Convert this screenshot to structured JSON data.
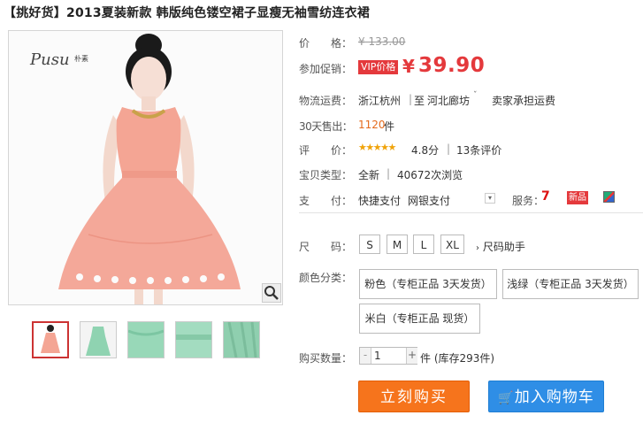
{
  "product": {
    "title": "【挑好货】2013夏装新款 韩版纯色镂空裙子显瘦无袖雪纺连衣裙",
    "brand_logo": "Pusu 朴素"
  },
  "price": {
    "label": "价　　格：",
    "original": "¥ 133.00",
    "promo_label": "参加促销：",
    "vip_tag": "VIP价格",
    "currency": "¥",
    "promo_value": "39.90"
  },
  "shipping": {
    "label": "物流运费：",
    "from": "浙江杭州",
    "sep": "|",
    "to_prefix": "至",
    "destination": "河北廊坊",
    "free_text": "卖家承担运费"
  },
  "sales": {
    "label": "30天售出：",
    "count": "1120",
    "unit": "件"
  },
  "rating": {
    "label": "评　　价：",
    "stars": "★★★★★",
    "score": "4.8分",
    "sep": "|",
    "reviews": "13条评价"
  },
  "item_type": {
    "label": "宝贝类型：",
    "condition": "全新",
    "sep": "|",
    "views": "40672次浏览"
  },
  "payment": {
    "label": "支　　付：",
    "method1": "快捷支付",
    "method2": "网银支付",
    "service_label": "服务：",
    "new_badge": "新品",
    "seven_days": "7"
  },
  "size": {
    "label": "尺　　码：",
    "options": [
      "S",
      "M",
      "L",
      "XL"
    ],
    "helper": "尺码助手"
  },
  "color": {
    "label": "颜色分类：",
    "options": [
      "粉色（专柜正品 3天发货）",
      "浅绿（专柜正品 3天发货）",
      "米白（专柜正品 现货）"
    ]
  },
  "quantity": {
    "label": "购买数量：",
    "minus": "-",
    "value": "1",
    "plus": "+",
    "stock": "件 (库存293件)"
  },
  "actions": {
    "buy_now": "立刻购买",
    "add_to_cart": "加入购物车"
  },
  "colors": {
    "price_orange": "#e4393c",
    "buy_button": "#f6741c",
    "cart_button": "#2f8ee6",
    "dress_pink": "#f3a99a",
    "dress_green": "#8fd3b1"
  }
}
